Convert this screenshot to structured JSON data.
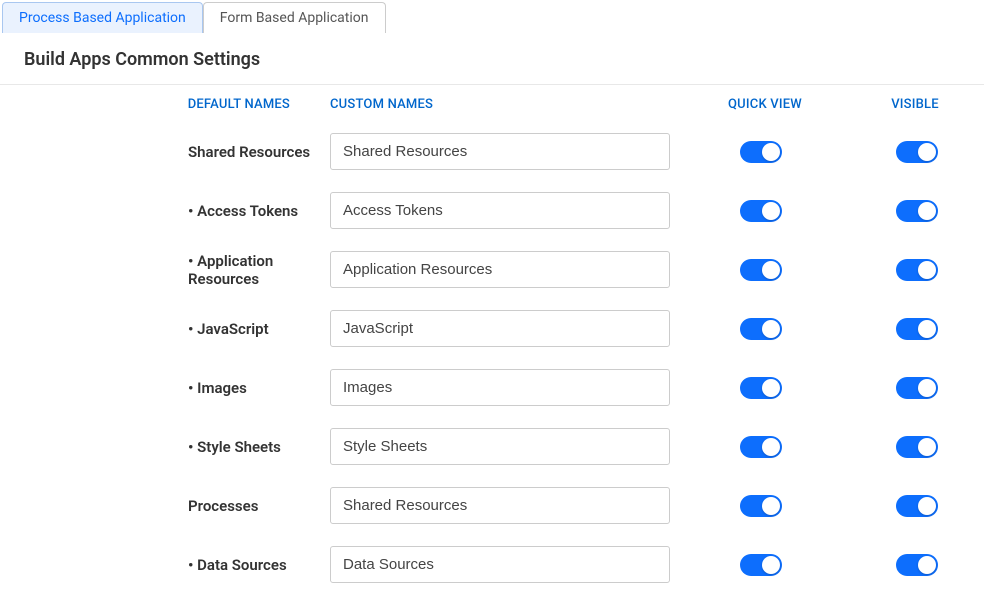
{
  "tabs": {
    "process": "Process Based Application",
    "form": "Form Based Application"
  },
  "section_title": "Build Apps Common Settings",
  "headers": {
    "default": "DEFAULT NAMES",
    "custom": "CUSTOM NAMES",
    "quick": "QUICK VIEW",
    "visible": "VISIBLE"
  },
  "rows": [
    {
      "default_label": "Shared Resources",
      "custom_value": "Shared Resources",
      "indented": false,
      "quick_view": true,
      "visible": true
    },
    {
      "default_label": "Access Tokens",
      "custom_value": "Access Tokens",
      "indented": true,
      "quick_view": true,
      "visible": true
    },
    {
      "default_label": "Application Resources",
      "custom_value": "Application Resources",
      "indented": true,
      "quick_view": true,
      "visible": true
    },
    {
      "default_label": "JavaScript",
      "custom_value": "JavaScript",
      "indented": true,
      "quick_view": true,
      "visible": true
    },
    {
      "default_label": "Images",
      "custom_value": "Images",
      "indented": true,
      "quick_view": true,
      "visible": true
    },
    {
      "default_label": "Style Sheets",
      "custom_value": "Style Sheets",
      "indented": true,
      "quick_view": true,
      "visible": true
    },
    {
      "default_label": "Processes",
      "custom_value": "Shared Resources",
      "indented": false,
      "quick_view": true,
      "visible": true
    },
    {
      "default_label": "Data Sources",
      "custom_value": "Data Sources",
      "indented": true,
      "quick_view": true,
      "visible": true
    }
  ]
}
